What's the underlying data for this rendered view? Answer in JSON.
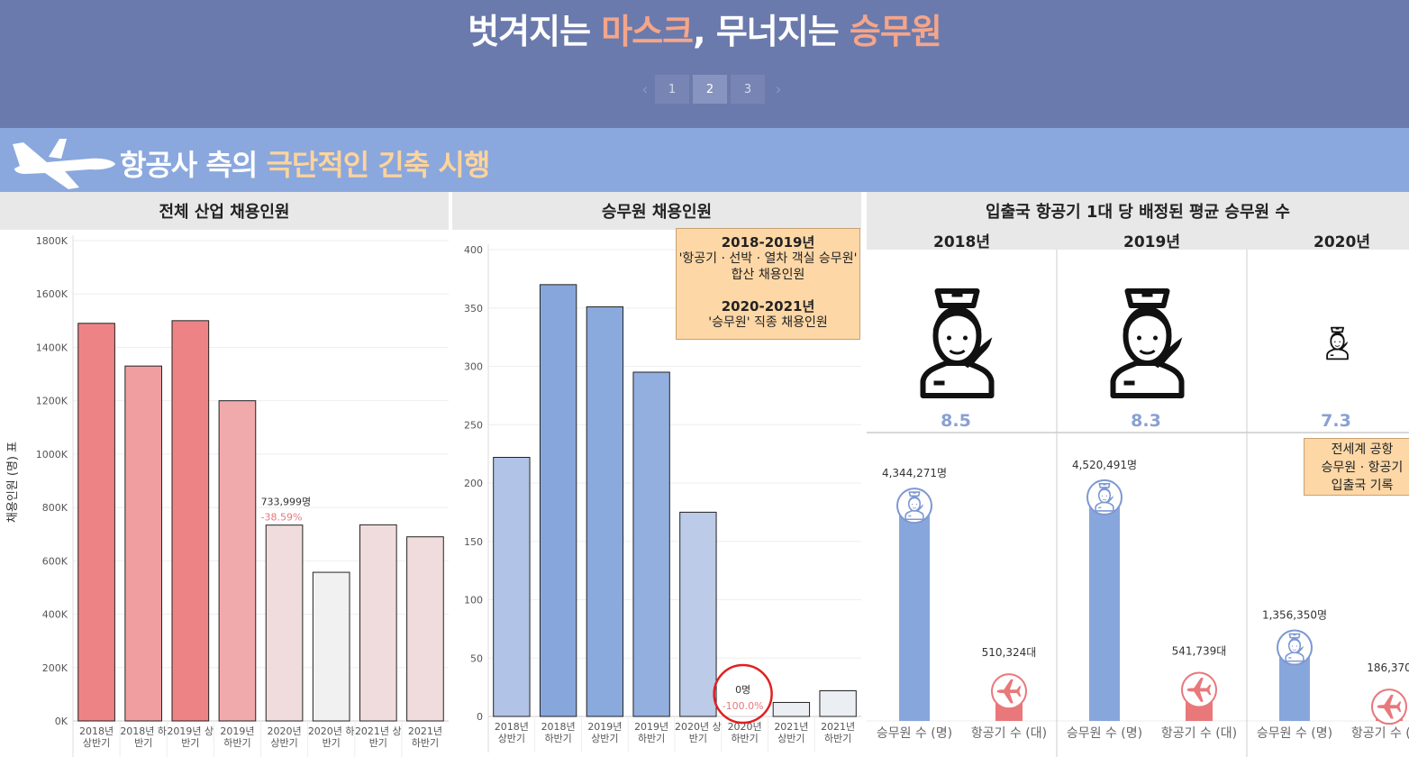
{
  "header": {
    "title_part1": "벗겨지는 ",
    "title_hl1": "마스크",
    "title_part2": ", 무너지는 ",
    "title_hl2": "승무원",
    "pages": [
      "1",
      "2",
      "3"
    ],
    "active_page": "2",
    "prev_label": "‹",
    "next_label": "›"
  },
  "section": {
    "title_part1": "항공사 측의 ",
    "title_hl": "극단적인 긴축 시행",
    "icon": "airplane-icon"
  },
  "colors": {
    "header_bg": "#6b7aac",
    "section_bg": "#8aa8dd",
    "title_highlight": "#f4a58a",
    "section_highlight": "#ffd39b",
    "legend_bg": "#fdd7a6",
    "crew_bar": "#87a7dc",
    "plane_circle": "#e8787a"
  },
  "chart_data": [
    {
      "type": "bar",
      "title": "전체 산업 채용인원",
      "ylabel": "채용인원 (명) 표",
      "categories": [
        [
          "2018년",
          "상반기"
        ],
        [
          "2018년 하",
          "반기"
        ],
        [
          "2019년 상",
          "반기"
        ],
        [
          "2019년",
          "하반기"
        ],
        [
          "2020년",
          "상반기"
        ],
        [
          "2020년 하",
          "반기"
        ],
        [
          "2021년 상",
          "반기"
        ],
        [
          "2021년",
          "하반기"
        ]
      ],
      "values": [
        1490000,
        1330000,
        1500000,
        1200000,
        733999,
        557000,
        735000,
        690000
      ],
      "bar_colors": [
        "#ee8385",
        "#f09e9f",
        "#ee8385",
        "#f0aaab",
        "#f0dcdc",
        "#f1f1f1",
        "#f0dcdc",
        "#f0dcdc"
      ],
      "yticks": [
        0,
        200000,
        400000,
        600000,
        800000,
        1000000,
        1200000,
        1400000,
        1600000,
        1800000
      ],
      "ytick_labels": [
        "0K",
        "200K",
        "400K",
        "600K",
        "800K",
        "1000K",
        "1200K",
        "1400K",
        "1600K",
        "1800K"
      ],
      "ylim": [
        0,
        1800000
      ],
      "annotation": {
        "index": 4,
        "value_label": "733,999명",
        "change_label": "-38.59%"
      },
      "grid": true
    },
    {
      "type": "bar",
      "title": "승무원 채용인원",
      "categories": [
        [
          "2018년",
          "상반기"
        ],
        [
          "2018년",
          "하반기"
        ],
        [
          "2019년",
          "상반기"
        ],
        [
          "2019년",
          "하반기"
        ],
        [
          "2020년 상",
          "반기"
        ],
        [
          "2020년",
          "하반기"
        ],
        [
          "2021년",
          "상반기"
        ],
        [
          "2021년",
          "하반기"
        ]
      ],
      "values": [
        222,
        370,
        351,
        295,
        175,
        0,
        12,
        22
      ],
      "bar_colors": [
        "#b1c3e6",
        "#87a7dc",
        "#8aaadd",
        "#92afdf",
        "#bccbe8",
        "#ebeff4",
        "#ebeff4",
        "#ebeff4"
      ],
      "yticks": [
        0,
        50,
        100,
        150,
        200,
        250,
        300,
        350,
        400
      ],
      "ylim": [
        0,
        400
      ],
      "annotation": {
        "index": 5,
        "value_label": "0명",
        "change_label": "-100.0%"
      },
      "legend": {
        "line1": "2018-2019년",
        "line2": "'항공기 · 선박 · 열차 객실 승무원'",
        "line3": "합산 채용인원",
        "line4": "2020-2021년",
        "line5": "'승무원' 직종 채용인원"
      },
      "grid": true
    },
    {
      "type": "bar",
      "title": "입출국 항공기 1대 당 배정된 평균 승무원 수",
      "years": [
        {
          "label": "2018년",
          "ratio": "8.5",
          "crew_value": 4344271,
          "crew_label": "4,344,271명",
          "plane_value": 510324,
          "plane_label": "510,324대"
        },
        {
          "label": "2019년",
          "ratio": "8.3",
          "crew_value": 4520491,
          "crew_label": "4,520,491명",
          "plane_value": 541739,
          "plane_label": "541,739대"
        },
        {
          "label": "2020년",
          "ratio": "7.3",
          "crew_value": 1356350,
          "crew_label": "1,356,350명",
          "plane_value": 186370,
          "plane_label": "186,370"
        }
      ],
      "categories": [
        "승무원 수 (명)",
        "항공기 수 (대)"
      ],
      "ylim": [
        0,
        5600000
      ],
      "note": {
        "line1": "전세계 공항",
        "line2": "승무원 · 항공기",
        "line3": "입출국 기록"
      }
    }
  ]
}
